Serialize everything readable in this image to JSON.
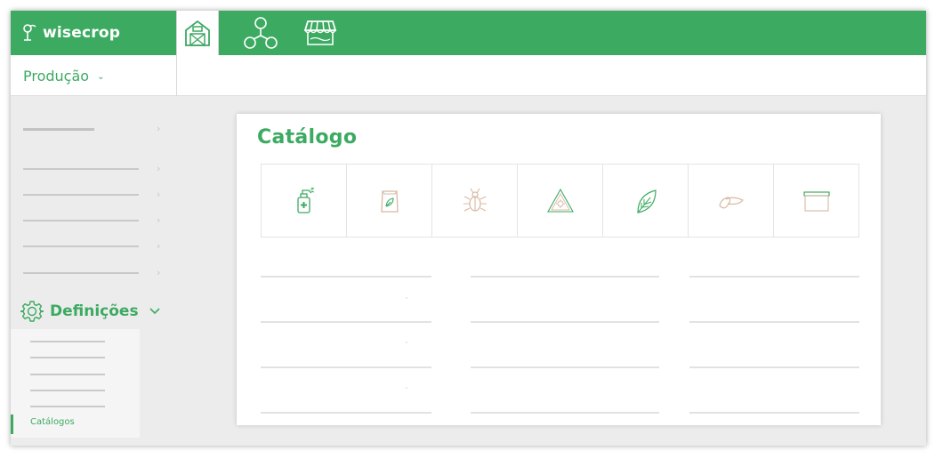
{
  "app": {
    "brand_name": "wisecrop",
    "module_label": "Produção",
    "top_nav": [
      {
        "icon": "barn-icon",
        "active": true
      },
      {
        "icon": "network-icon",
        "active": false
      },
      {
        "icon": "market-stall-icon",
        "active": false
      }
    ]
  },
  "sidebar": {
    "settings_label": "Definições",
    "active_item_label": "Catálogos"
  },
  "catalog": {
    "title": "Catálogo",
    "tiles": [
      {
        "icon": "sprayer-icon"
      },
      {
        "icon": "fertilizer-bag-icon"
      },
      {
        "icon": "bug-icon"
      },
      {
        "icon": "warning-triangle-icon"
      },
      {
        "icon": "leaf-icon"
      },
      {
        "icon": "seed-icon"
      },
      {
        "icon": "container-icon"
      }
    ]
  },
  "colors": {
    "accent": "#3daa62",
    "background": "#ececec",
    "tile_icon_beige": "#d9b8a3"
  }
}
